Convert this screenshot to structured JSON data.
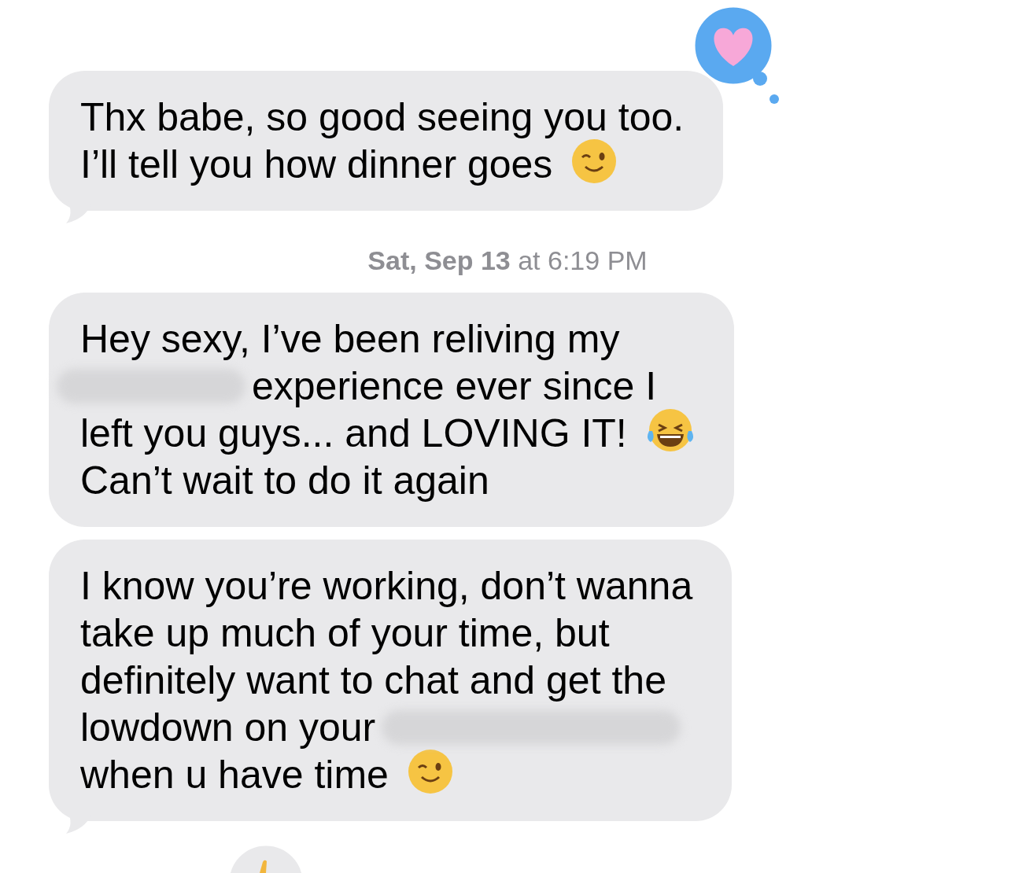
{
  "top_reaction": {
    "kind": "heart"
  },
  "messages": [
    {
      "tail": true,
      "lines": [
        [
          {
            "kind": "text",
            "text": "Thx babe, so good seeing you too."
          }
        ],
        [
          {
            "kind": "text",
            "text": "I’ll tell you how dinner goes"
          },
          {
            "kind": "wink"
          }
        ]
      ]
    },
    {
      "timestamp": "**Sat, Sep 13** at 6:19 PM",
      "tail": false,
      "lines": [
        [
          {
            "kind": "text",
            "text": "Hey sexy, I’ve been reliving my"
          }
        ],
        [
          {
            "kind": "redacted"
          },
          {
            "kind": "text",
            "text": "experience ever since I"
          }
        ],
        [
          {
            "kind": "text",
            "text": "left you guys... and LOVING IT!"
          },
          {
            "kind": "laugh"
          }
        ],
        [
          {
            "kind": "text",
            "text": "Can’t wait to do it again"
          }
        ]
      ]
    },
    {
      "tail": true,
      "lines": [
        [
          {
            "kind": "text",
            "text": "I know you’re working, don’t wanna"
          }
        ],
        [
          {
            "kind": "text",
            "text": "take up much of your time, but"
          }
        ],
        [
          {
            "kind": "text",
            "text": "definitely want to chat and get the"
          }
        ],
        [
          {
            "kind": "text",
            "text": "lowdown on your"
          },
          {
            "kind": "redacted"
          }
        ],
        [
          {
            "kind": "text",
            "text": "when u have time"
          },
          {
            "kind": "wink"
          }
        ]
      ]
    }
  ],
  "bottom_reaction": {
    "kind": "hand"
  }
}
